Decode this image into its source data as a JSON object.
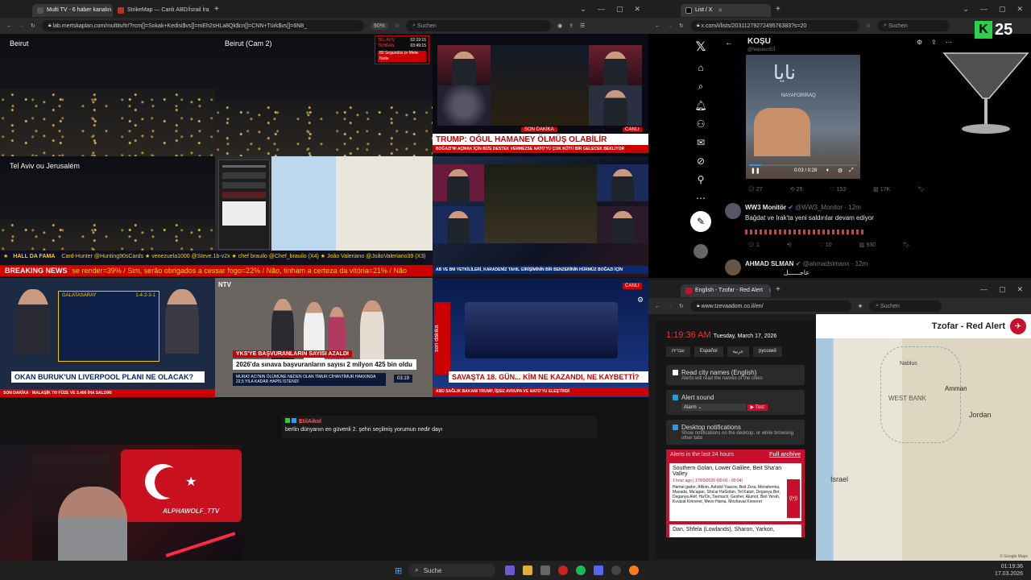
{
  "left_window": {
    "tabs": [
      {
        "label": "Multi TV - 6 haber kanalın"
      },
      {
        "label": "StrikeMap — Canlı ABD/İsrail İra"
      }
    ],
    "url": "lab.mertskaplan.com/multitv/tr/?rcm[]=Sokak+Kedisi$vs[]=mEh2sHLa8Qk$cn[]=CNN+Türk$vs[]=6N8_",
    "zoom": "90%",
    "search_placeholder": "Suchen",
    "cells": {
      "beirut": "Beirut",
      "beirut_cam2": "Beirut (Cam 2)",
      "telaviv": "Tel Aviv ou Jerusalém",
      "clock": {
        "city1": "TEL AVIV",
        "time1": "02:19:15",
        "city2": "TEHRAN",
        "time2": "03:49:15",
        "caption": "80 Segundos pr Meia-Noite"
      },
      "cnn_ticker": "TRUMP: OĞUL HAMANEY ÖLMÜŞ OLABİLİR",
      "cnn_breaking": "SON DAKİKA",
      "cnn_sub": "BOĞAZI'NI AÇMAK İÇİN BİZE DESTEK VERMEZSE NATO'YU ÇOK KÖTÜ BİR GELECEK BEKLİYOR",
      "cnn_logo": "CNN TÜRK",
      "cnn_live": "CANLI",
      "tv2_ticker": "AB VE BM YETKİLİLERİ, KARADENİZ TAHIL GİRİŞİMİNİN BİR BENZERİNİN HÜRMÜZ BOĞAZI İÇİN",
      "hall_of_fame": "HALL DA FAMA",
      "fame_names": "Card-Hunter @Hunting90sCards ★ venezuela1000 @Steve.1b-v2x ★ chef brauilo @Chef_brauilo (X4) ★ João Valeriano @JoãoValeriano39 (X3)",
      "breaking_label": "BREAKING NEWS",
      "breaking_text": "se render=39% / Sim, serão obrigados a cessar fogo=22% / Não, tinham a certeza da vitória=21% / Não",
      "sport_team": "GALATASARAY",
      "sport_formation": "1-4-2-3-1",
      "sport_headline": "OKAN BURUK'UN LIVERPOOL PLANI NE OLACAK?",
      "sport_sub": "SON DAKİKA · MALAŞİK 7/0 FÜZE VE 3.400 İHA SALDIRI",
      "ntv_sub": "YKS'YE BAŞVURANLARIN SAYISI AZALDI",
      "ntv_headline": "2026'da sınava başvuranların sayısı 2 milyon 425 bin oldu",
      "ntv_ticker": "MURAT ACI'NIN ÖLÜMÜNE NEDEN OLAN TİMUR CİHANTİMUR HAKKINDA 22,5 YILA KADAR HAPİS İSTENDİ",
      "ntv_time": "03:19",
      "ntv_logo": "NTV",
      "a_headline": "SAVAŞTA 18. GÜN... KİM NE KAZANDI, NE KAYBETTİ?",
      "a_sub": "ABD SAĞLIK BAKANI TRUMP, İŞSIZ AVRUPA VE NATO'YU ELEŞTİRDİ",
      "a_tag": "son dakika",
      "a_live": "CANLI"
    },
    "chat": {
      "user": "EtilAikol",
      "message": "berlin dünyanın en güvenli 2. şehri seçilmiş yorumun nedir dayı"
    }
  },
  "x_window": {
    "tabs": [
      {
        "label": "List / X"
      }
    ],
    "url": "x.com/i/lists/2031127927249576383?s=20",
    "search_placeholder": "Suchen",
    "list_title": "KOŞU",
    "list_handle": "@fequeun53",
    "video_time": "0:03 / 0:28",
    "video_arabic": "نايا",
    "video_brand": "NAYAFORIRAQ",
    "stats1": {
      "replies": "27",
      "reposts": "25",
      "likes": "153",
      "views": "17K"
    },
    "tweet2": {
      "name": "WW3 Monitör",
      "handle": "@WW3_Monitor · 12m",
      "text": "Bağdat ve Irak'ta yeni saldırılar devam ediyor"
    },
    "stats2": {
      "replies": "1",
      "reposts": "",
      "likes": "10",
      "views": "930"
    },
    "tweet3": {
      "name": "AHMAD SLMAN",
      "handle": "@ahmadslmanx · 12m",
      "text": "عاجــــــل"
    },
    "overlay_badge": "25"
  },
  "alert_window": {
    "tabs": [
      {
        "label": "English - Tzofar - Red Alert"
      }
    ],
    "url": "www.tzevaadom.co.il/en/",
    "search_placeholder": "Suchen",
    "time": "1:19:36 AM",
    "date": "Tuesday, March 17, 2026",
    "languages": [
      "עברית",
      "Español",
      "عربية",
      "русский"
    ],
    "read_city_title": "Read city names (English)",
    "read_city_desc": "Alerts will read the names of the cities",
    "alert_sound_title": "Alert sound",
    "alarm_option": "Alarm",
    "test_label": "▶ Test",
    "desktop_title": "Desktop notifications",
    "desktop_desc": "Show notifications on the desktop, or while browsing other tabs",
    "last24": "Alerts in the last 24 hours",
    "full_archive": "Full archive",
    "alert1_title": "Southern Golan, Lower Galilee, Beit Sha'an Valley",
    "alert1_time": "1 hour ago | 17/03/2026 (00:01 - 00:04)",
    "alert1_text": "Hamat gader, Afikim, Ashdot Yaacov, Beit Zera, Menahemia, Masada, Ma'agan, Sha'ar HaGolan, Tel Katzir, Deganya Bet, Deganya Alef, Ha'On, Tsemach, Gesher, Alumot, Beit Yerah, Kvutzat Kinneret, Mevo Hama, Moshavat Kinneret",
    "alert2_title": "Dan, Shfela (Lowlands), Sharon, Yarkon,",
    "map_title": "Tzofar - Red Alert",
    "map_labels": {
      "nablus": "Nablus",
      "amman": "Amman",
      "west_bank": "WEST BANK",
      "jordan": "Jordan",
      "israel": "Israel",
      "google": "© Google Maps"
    }
  },
  "webcam": {
    "flag_text": "ALPHAWOLF_TTV"
  },
  "taskbar": {
    "search": "Suche",
    "time": "01:19:36",
    "date": "17.03.2026"
  },
  "colors": {
    "cnn_red": "#cc0000",
    "alert_red": "#c8102e",
    "x_blue": "#1d9bf0",
    "breaking_bar": "#cc0000",
    "fame_bar": "#101020"
  }
}
